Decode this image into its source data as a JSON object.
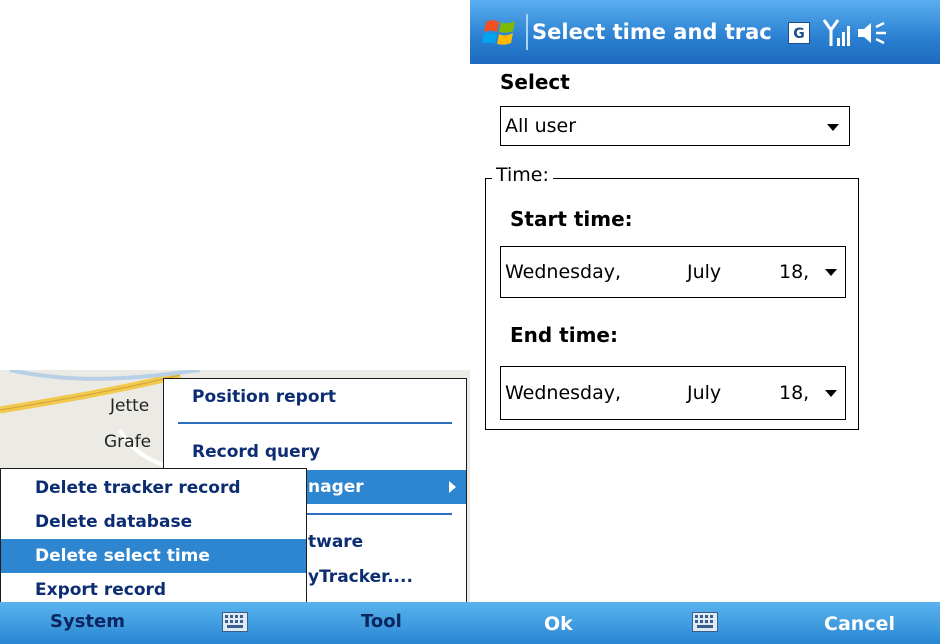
{
  "left_phone": {
    "map": {
      "labels": [
        "Jette",
        "Grafe"
      ]
    },
    "tool_menu": {
      "items": [
        {
          "label": "Position report"
        },
        {
          "label": "Record query"
        },
        {
          "label": "nager"
        },
        {
          "label": "tware"
        },
        {
          "label": "yTracker...."
        }
      ]
    },
    "system_menu": {
      "items": [
        {
          "label": "Delete tracker record"
        },
        {
          "label": "Delete database"
        },
        {
          "label": "Delete select time"
        },
        {
          "label": "Export record"
        }
      ],
      "selected_index": 2
    },
    "softbar": {
      "left_label": "System",
      "right_label": "Tool",
      "center_icon": "keyboard-icon"
    }
  },
  "right_phone": {
    "title": "Select time and tracl",
    "status_icons": [
      "windows-start-icon",
      "gprs-g-icon",
      "signal-icon",
      "speaker-icon"
    ],
    "select_label": "Select",
    "user_dropdown": {
      "value": "All user"
    },
    "time_group_legend": "Time:",
    "start_time": {
      "label": "Start time:",
      "day": "Wednesday,",
      "month": "July",
      "date": "18,"
    },
    "end_time": {
      "label": "End time:",
      "day": "Wednesday,",
      "month": "July",
      "date": "18,"
    },
    "softbar": {
      "left_label": "Ok",
      "right_label": "Cancel",
      "center_icon": "keyboard-icon"
    }
  },
  "colors": {
    "menu_text": "#0d2d73",
    "selection": "#2f86d0",
    "titlebar": "#2a7fd0",
    "softbar": "#2a86d2"
  }
}
